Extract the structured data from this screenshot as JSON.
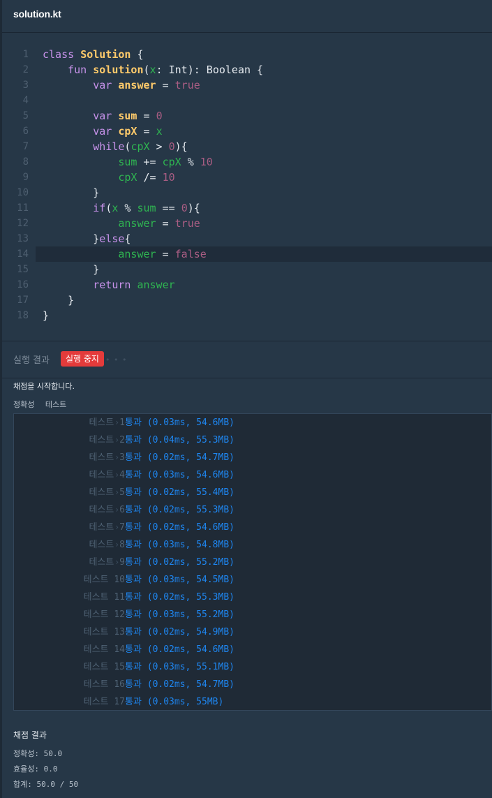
{
  "tab": {
    "title": "solution.kt"
  },
  "code_lines": [
    {
      "n": "1",
      "parts": [
        [
          "k",
          "class "
        ],
        [
          "f",
          "Solution"
        ],
        [
          "t",
          " {"
        ]
      ]
    },
    {
      "n": "2",
      "parts": [
        [
          "t",
          "    "
        ],
        [
          "k",
          "fun "
        ],
        [
          "f",
          "solution"
        ],
        [
          "t",
          "("
        ],
        [
          "v",
          "x"
        ],
        [
          "t",
          ": Int): Boolean {"
        ]
      ]
    },
    {
      "n": "3",
      "parts": [
        [
          "t",
          "        "
        ],
        [
          "k",
          "var "
        ],
        [
          "f",
          "answer"
        ],
        [
          "t",
          " = "
        ],
        [
          "n",
          "true"
        ]
      ]
    },
    {
      "n": "4",
      "parts": []
    },
    {
      "n": "5",
      "parts": [
        [
          "t",
          "        "
        ],
        [
          "k",
          "var "
        ],
        [
          "f",
          "sum"
        ],
        [
          "t",
          " = "
        ],
        [
          "n",
          "0"
        ]
      ]
    },
    {
      "n": "6",
      "parts": [
        [
          "t",
          "        "
        ],
        [
          "k",
          "var "
        ],
        [
          "f",
          "cpX"
        ],
        [
          "t",
          " = "
        ],
        [
          "v",
          "x"
        ]
      ]
    },
    {
      "n": "7",
      "parts": [
        [
          "t",
          "        "
        ],
        [
          "k",
          "while"
        ],
        [
          "t",
          "("
        ],
        [
          "v",
          "cpX"
        ],
        [
          "t",
          " > "
        ],
        [
          "n",
          "0"
        ],
        [
          "t",
          "){"
        ]
      ]
    },
    {
      "n": "8",
      "parts": [
        [
          "t",
          "            "
        ],
        [
          "v",
          "sum"
        ],
        [
          "t",
          " += "
        ],
        [
          "v",
          "cpX"
        ],
        [
          "t",
          " % "
        ],
        [
          "n",
          "10"
        ]
      ]
    },
    {
      "n": "9",
      "parts": [
        [
          "t",
          "            "
        ],
        [
          "v",
          "cpX"
        ],
        [
          "t",
          " /= "
        ],
        [
          "n",
          "10"
        ]
      ]
    },
    {
      "n": "10",
      "parts": [
        [
          "t",
          "        }"
        ]
      ]
    },
    {
      "n": "11",
      "parts": [
        [
          "t",
          "        "
        ],
        [
          "k",
          "if"
        ],
        [
          "t",
          "("
        ],
        [
          "v",
          "x"
        ],
        [
          "t",
          " % "
        ],
        [
          "v",
          "sum"
        ],
        [
          "t",
          " == "
        ],
        [
          "n",
          "0"
        ],
        [
          "t",
          "){"
        ]
      ]
    },
    {
      "n": "12",
      "parts": [
        [
          "t",
          "            "
        ],
        [
          "v",
          "answer"
        ],
        [
          "t",
          " = "
        ],
        [
          "n",
          "true"
        ]
      ]
    },
    {
      "n": "13",
      "parts": [
        [
          "t",
          "        }"
        ],
        [
          "k",
          "else"
        ],
        [
          "t",
          "{"
        ]
      ]
    },
    {
      "n": "14",
      "parts": [
        [
          "t",
          "            "
        ],
        [
          "v",
          "answer"
        ],
        [
          "t",
          " = "
        ],
        [
          "n",
          "false"
        ]
      ],
      "active": true
    },
    {
      "n": "15",
      "parts": [
        [
          "t",
          "        }"
        ]
      ]
    },
    {
      "n": "16",
      "parts": [
        [
          "t",
          "        "
        ],
        [
          "k",
          "return "
        ],
        [
          "v",
          "answer"
        ]
      ]
    },
    {
      "n": "17",
      "parts": [
        [
          "t",
          "    }"
        ]
      ]
    },
    {
      "n": "18",
      "parts": [
        [
          "t",
          "}"
        ]
      ]
    }
  ],
  "results": {
    "title": "실행 결과",
    "stop_label": "실행 중지",
    "dots": "• • •",
    "start_message": "채점을 시작합니다.",
    "label_accuracy": "정확성",
    "label_test": "테스트"
  },
  "tests": [
    {
      "name": "테스트 1",
      "result": "통과 (0.03ms, 54.6MB)"
    },
    {
      "name": "테스트 2",
      "result": "통과 (0.04ms, 55.3MB)"
    },
    {
      "name": "테스트 3",
      "result": "통과 (0.02ms, 54.7MB)"
    },
    {
      "name": "테스트 4",
      "result": "통과 (0.03ms, 54.6MB)"
    },
    {
      "name": "테스트 5",
      "result": "통과 (0.02ms, 55.4MB)"
    },
    {
      "name": "테스트 6",
      "result": "통과 (0.02ms, 55.3MB)"
    },
    {
      "name": "테스트 7",
      "result": "통과 (0.02ms, 54.6MB)"
    },
    {
      "name": "테스트 8",
      "result": "통과 (0.03ms, 54.8MB)"
    },
    {
      "name": "테스트 9",
      "result": "통과 (0.02ms, 55.2MB)"
    },
    {
      "name": "테스트 10",
      "result": "통과 (0.03ms, 54.5MB)"
    },
    {
      "name": "테스트 11",
      "result": "통과 (0.02ms, 55.3MB)"
    },
    {
      "name": "테스트 12",
      "result": "통과 (0.03ms, 55.2MB)"
    },
    {
      "name": "테스트 13",
      "result": "통과 (0.02ms, 54.9MB)"
    },
    {
      "name": "테스트 14",
      "result": "통과 (0.02ms, 54.6MB)"
    },
    {
      "name": "테스트 15",
      "result": "통과 (0.03ms, 55.1MB)"
    },
    {
      "name": "테스트 16",
      "result": "통과 (0.02ms, 54.7MB)"
    },
    {
      "name": "테스트 17",
      "result": "통과 (0.03ms, 55MB)"
    }
  ],
  "arrow_glyph": "›",
  "score": {
    "title": "채점 결과",
    "accuracy": "정확성: 50.0",
    "efficiency": "효율성: 0.0",
    "total": "합계: 50.0 / 50"
  }
}
